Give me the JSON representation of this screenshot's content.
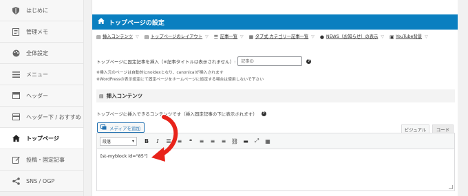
{
  "sidebar": {
    "items": [
      {
        "label": "はじめに",
        "icon": "shield-icon",
        "active": false
      },
      {
        "label": "管理メモ",
        "icon": "memo-icon",
        "active": false
      },
      {
        "label": "全体設定",
        "icon": "palette-icon",
        "active": false
      },
      {
        "label": "メニュー",
        "icon": "menu-icon",
        "active": false
      },
      {
        "label": "ヘッダー",
        "icon": "header-icon",
        "active": false
      },
      {
        "label": "ヘッダー下 / おすすめ",
        "icon": "header-below-icon",
        "active": false
      },
      {
        "label": "トップページ",
        "icon": "home-icon",
        "active": true
      },
      {
        "label": "投稿・固定記事",
        "icon": "edit-icon",
        "active": false
      },
      {
        "label": "SNS / OGP",
        "icon": "share-icon",
        "active": false
      }
    ]
  },
  "panel": {
    "title": "トップページの設定",
    "anchors": [
      {
        "label": "挿入コンテンツ",
        "icon": "doc-icon"
      },
      {
        "label": "トップページのレイアウト",
        "icon": "doc-icon"
      },
      {
        "label": "記事一覧",
        "icon": "list-icon"
      },
      {
        "label": "タブ式 カテゴリー記事一覧",
        "icon": "grid-icon"
      },
      {
        "label": "NEWS（お知らせ）の表示",
        "icon": "info-icon"
      },
      {
        "label": "YouTube背景",
        "icon": "video-icon"
      }
    ],
    "fixed_page_label": "トップページに固定記事を挿入（※記事タイトルは表示されません）:",
    "fixed_page_placeholder": "記事ID",
    "note1": "※挿入元のページは自動的にnoidexとなり、canonicalが挿入されます",
    "note2": "※WordPressの表示設定にて固定ページをホームページに設定する場合は使用しないで下さい",
    "section_title": "挿入コンテンツ",
    "section_desc": "トップページに挿入できるコンテンツです（挿入固定記事の下に表示されます）",
    "media_button": "メディアを追加",
    "tab_visual": "ビジュアル",
    "tab_code": "コード",
    "format_select": "段落",
    "editor_content": "[st-myblock id=\"85\"]"
  },
  "colors": {
    "header_bg": "#0a7fc0",
    "arrow": "#e8231a",
    "link_blue": "#2271b1"
  }
}
